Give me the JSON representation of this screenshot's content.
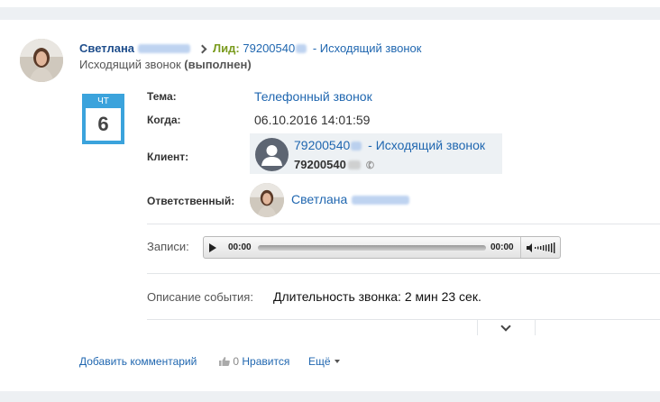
{
  "header": {
    "author_name": "Светлана",
    "lead_label": "Лид:",
    "lead_number": "79200540",
    "lead_number_tail": "547",
    "lead_suffix": " - Исходящий звонок",
    "subtitle_text": "Исходящий звонок ",
    "subtitle_status": "(выполнен)"
  },
  "calendar": {
    "weekday": "ЧТ",
    "day": "6"
  },
  "fields": {
    "topic_label": "Тема:",
    "topic_value": "Телефонный звонок",
    "when_label": "Когда:",
    "when_value": "06.10.2016 14:01:59",
    "client_label": "Клиент:",
    "client_link_prefix": "79200540",
    "client_link_tail": "547",
    "client_link_suffix": " - Исходящий звонок",
    "client_phone_prefix": "79200540",
    "client_phone_tail": "547",
    "responsible_label": "Ответственный:",
    "responsible_name": "Светлана"
  },
  "recording": {
    "label": "Записи:",
    "time_start": "00:00",
    "time_end": "00:00"
  },
  "description": {
    "label": "Описание события:",
    "value": "Длительность звонка: 2 мин 23 сек."
  },
  "footer": {
    "add_comment": "Добавить комментарий",
    "likes_count": "0",
    "like_label": "Нравится",
    "more_label": "Ещё"
  },
  "icons": [
    "avatar",
    "chevron-right-icon",
    "calendar-icon",
    "client-person-icon",
    "phone-icon",
    "play-icon",
    "volume-icon",
    "chevron-down-icon",
    "thumb-up-icon",
    "caret-down-icon"
  ],
  "colors": {
    "link": "#2067b0",
    "lead_label": "#7a9b1e",
    "calendar": "#3ba3dc",
    "client_card_bg": "#edf1f4"
  }
}
